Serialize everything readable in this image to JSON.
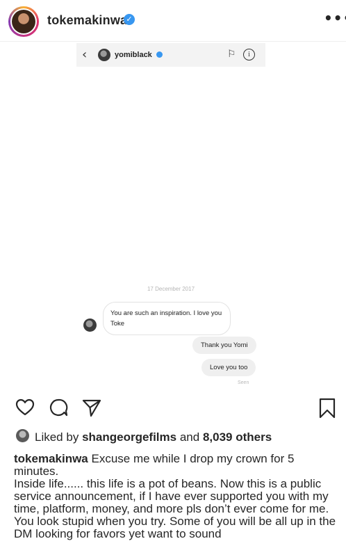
{
  "post": {
    "username": "tokemakinwa",
    "verified_mark": "✓",
    "more_icon": "•••"
  },
  "dm": {
    "contact_name": "yomiblack",
    "back_icon": "‹",
    "flag_icon": "⚐",
    "info_icon": "i",
    "date": "17 December 2017",
    "messages": [
      {
        "from": "them",
        "text": "You are such an inspiration. I love you Toke"
      },
      {
        "from": "me",
        "text": "Thank you Yomi"
      },
      {
        "from": "me",
        "text": "Love you too"
      }
    ],
    "seen_label": "Seen"
  },
  "actions": {
    "icons": [
      "heart-icon",
      "comment-icon",
      "share-icon",
      "bookmark-icon"
    ]
  },
  "likes": {
    "prefix": "Liked by",
    "liker": "shangeorgefilms",
    "conjunction": "and",
    "others": "8,039 others"
  },
  "caption": {
    "username": "tokemakinwa",
    "line1": "Excuse me while I drop my crown for 5 minutes.",
    "body": "Inside life...... this life is a pot of beans. Now this  is a public service announcement, if I have ever supported you with my time, platform, money, and more pls don’t ever come for me. You look stupid when you try. Some of you will be all up in the DM looking for favors yet want to sound"
  },
  "colors": {
    "verified_blue": "#3897f0",
    "text": "#262626",
    "bubble_gray": "#efefef"
  }
}
